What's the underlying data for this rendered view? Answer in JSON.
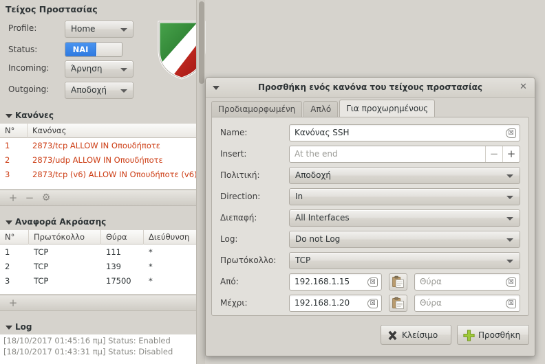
{
  "main": {
    "title": "Τείχος Προστασίας",
    "settings": [
      {
        "label": "Profile:",
        "value": "Home",
        "type": "combo"
      },
      {
        "label": "Status:",
        "value": "ΝΑΙ",
        "type": "toggle"
      },
      {
        "label": "Incoming:",
        "value": "Άρνηση",
        "type": "combo"
      },
      {
        "label": "Outgoing:",
        "value": "Αποδοχή",
        "type": "combo"
      }
    ],
    "rules_section": {
      "title": "Κανόνες",
      "columns": [
        "N°",
        "Κανόνας"
      ],
      "rows": [
        {
          "n": "1",
          "rule": "2873/tcp ALLOW IN Οπουδήποτε"
        },
        {
          "n": "2",
          "rule": "2873/udp ALLOW IN Οπουδήποτε"
        },
        {
          "n": "3",
          "rule": "2873/tcp (v6) ALLOW IN Οπουδήποτε (v6)"
        }
      ],
      "toolbar": [
        "add-icon",
        "remove-icon",
        "gear-icon"
      ]
    },
    "listening_section": {
      "title": "Αναφορά Ακρόασης",
      "columns": [
        "N°",
        "Πρωτόκολλο",
        "Θύρα",
        "Διεύθυνση"
      ],
      "rows": [
        {
          "n": "1",
          "protocol": "TCP",
          "port": "111",
          "address": "*"
        },
        {
          "n": "2",
          "protocol": "TCP",
          "port": "139",
          "address": "*"
        },
        {
          "n": "3",
          "protocol": "TCP",
          "port": "17500",
          "address": "*"
        }
      ],
      "toolbar": [
        "add-icon"
      ]
    },
    "log_section": {
      "title": "Log",
      "lines": [
        "[18/10/2017 01:45:16 πμ] Status: Enabled",
        "[18/10/2017 01:43:31 πμ] Status: Disabled"
      ]
    }
  },
  "dialog": {
    "title": "Προσθήκη ενός κανόνα του τείχους προστασίας",
    "close_label": "✕",
    "tabs": [
      {
        "label": "Προδιαμορφωμένη",
        "active": false
      },
      {
        "label": "Απλό",
        "active": false
      },
      {
        "label": "Για προχωρημένους",
        "active": true
      }
    ],
    "form": {
      "name": {
        "label": "Name:",
        "value": "Κανόνας SSH"
      },
      "insert": {
        "label": "Insert:",
        "placeholder": "At the end",
        "minus": "−",
        "plus": "+"
      },
      "policy": {
        "label": "Πολιτική:",
        "value": "Αποδοχή"
      },
      "direction": {
        "label": "Direction:",
        "value": "In"
      },
      "interface": {
        "label": "Διεπαφή:",
        "value": "All Interfaces"
      },
      "log": {
        "label": "Log:",
        "value": "Do not Log"
      },
      "protocol": {
        "label": "Πρωτόκολλο:",
        "value": "TCP"
      },
      "from": {
        "label": "Από:",
        "ip": "192.168.1.15",
        "port_placeholder": "Θύρα"
      },
      "to": {
        "label": "Μέχρι:",
        "ip": "192.168.1.20",
        "port_placeholder": "Θύρα"
      }
    },
    "buttons": {
      "close": "Κλείσιμο",
      "add": "Προσθήκη"
    }
  },
  "colors": {
    "accent_blue": "#3b82e0",
    "rule_red": "#cc3b12",
    "shield_green": "#2f8a33",
    "shield_red": "#c01c1c",
    "window_bg": "#d6d3cd"
  }
}
